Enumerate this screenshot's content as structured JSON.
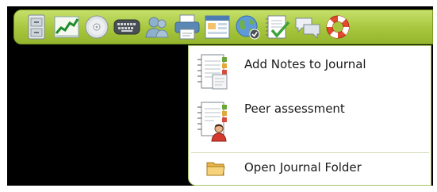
{
  "toolbar": {
    "buttons": [
      {
        "icon": "file-cabinet-icon"
      },
      {
        "icon": "line-chart-icon"
      },
      {
        "icon": "disc-icon"
      },
      {
        "icon": "keyboard-icon"
      },
      {
        "icon": "users-icon"
      },
      {
        "icon": "printer-icon"
      },
      {
        "icon": "calendar-window-icon"
      },
      {
        "icon": "globe-icon"
      },
      {
        "icon": "journal-check-icon"
      },
      {
        "icon": "chat-bubbles-icon"
      },
      {
        "icon": "life-ring-icon"
      }
    ],
    "accent": "#a7c63d"
  },
  "menu": {
    "items": [
      {
        "label": "Add Notes to Journal",
        "icon": "journal-notes-icon"
      },
      {
        "label": "Peer assessment",
        "icon": "journal-person-icon"
      },
      {
        "label": "Open Journal Folder",
        "icon": "folder-icon"
      }
    ]
  }
}
